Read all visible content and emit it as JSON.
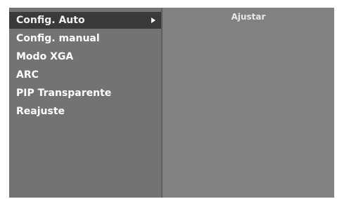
{
  "menu": {
    "items": [
      {
        "label": "Config. Auto",
        "selected": true
      },
      {
        "label": "Config. manual",
        "selected": false
      },
      {
        "label": "Modo XGA",
        "selected": false
      },
      {
        "label": "ARC",
        "selected": false
      },
      {
        "label": "PIP Transparente",
        "selected": false
      },
      {
        "label": "Reajuste",
        "selected": false
      }
    ]
  },
  "submenu": {
    "title": "Ajustar"
  },
  "colors": {
    "panel_bg": "#737373",
    "highlight_bg": "#3a3a3a",
    "text": "#ffffff"
  },
  "icons": {
    "submenu_arrow": "arrow-right-icon"
  }
}
